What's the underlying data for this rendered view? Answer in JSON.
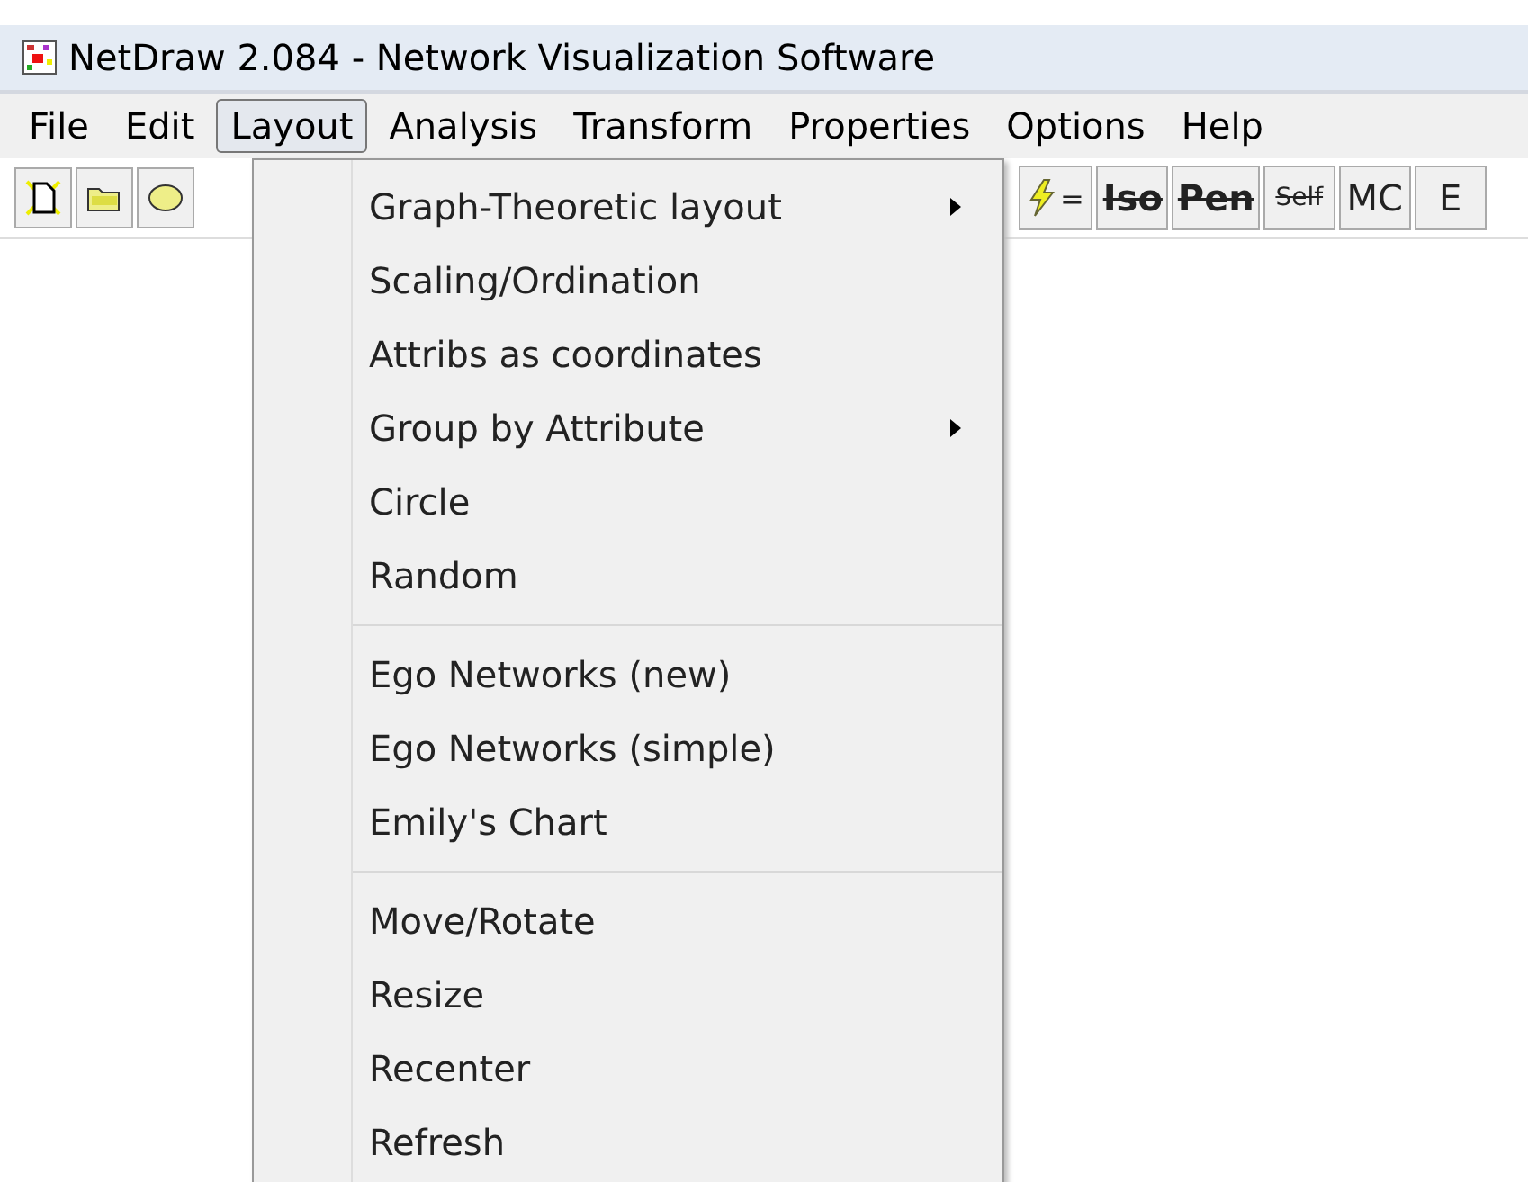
{
  "window": {
    "title": "NetDraw 2.084 - Network Visualization Software"
  },
  "menu_bar": [
    {
      "label": "File",
      "selected": false
    },
    {
      "label": "Edit",
      "selected": false
    },
    {
      "label": "Layout",
      "selected": true
    },
    {
      "label": "Analysis",
      "selected": false
    },
    {
      "label": "Transform",
      "selected": false
    },
    {
      "label": "Properties",
      "selected": false
    },
    {
      "label": "Options",
      "selected": false
    },
    {
      "label": "Help",
      "selected": false
    }
  ],
  "toolbar_left": [
    {
      "kind": "new"
    },
    {
      "kind": "open"
    },
    {
      "kind": "save"
    }
  ],
  "toolbar_right": [
    {
      "kind": "lightning",
      "label": "="
    },
    {
      "kind": "text",
      "label": "Iso",
      "struck": true,
      "bold": true
    },
    {
      "kind": "text",
      "label": "Pen",
      "struck": true,
      "bold": true
    },
    {
      "kind": "small",
      "label": "Self",
      "struck": true,
      "bold": false
    },
    {
      "kind": "text",
      "label": "MC",
      "struck": false,
      "bold": false
    },
    {
      "kind": "text",
      "label": "E",
      "struck": false,
      "bold": false
    }
  ],
  "dropdown": {
    "groups": [
      [
        {
          "label": "Graph-Theoretic layout",
          "submenu": true
        },
        {
          "label": "Scaling/Ordination",
          "submenu": false
        },
        {
          "label": "Attribs as coordinates",
          "submenu": false
        },
        {
          "label": "Group by Attribute",
          "submenu": true
        },
        {
          "label": "Circle",
          "submenu": false
        },
        {
          "label": "Random",
          "submenu": false
        }
      ],
      [
        {
          "label": "Ego Networks (new)",
          "submenu": false
        },
        {
          "label": "Ego Networks (simple)",
          "submenu": false
        },
        {
          "label": "Emily's Chart",
          "submenu": false
        }
      ],
      [
        {
          "label": "Move/Rotate",
          "submenu": false
        },
        {
          "label": "Resize",
          "submenu": false
        },
        {
          "label": "Recenter",
          "submenu": false
        },
        {
          "label": "Refresh",
          "submenu": false
        }
      ]
    ]
  }
}
